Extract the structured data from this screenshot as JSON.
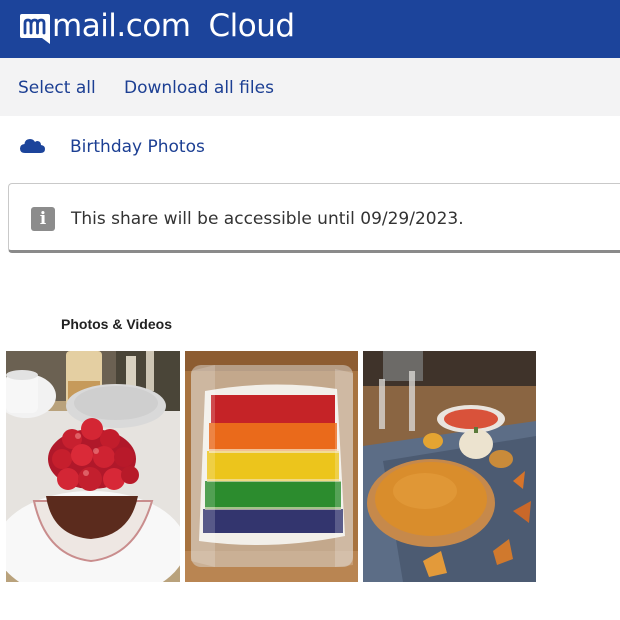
{
  "header": {
    "brand_mail": "mail.com",
    "brand_product": "Cloud",
    "colors": {
      "bar": "#1c449b",
      "text": "#ffffff"
    }
  },
  "toolbar": {
    "select_all": "Select all",
    "download_all": "Download all files"
  },
  "folder": {
    "icon": "cloud-icon",
    "name": "Birthday Photos"
  },
  "notice": {
    "icon": "info-icon",
    "icon_glyph": "i",
    "text": "This share will be accessible until 09/29/2023."
  },
  "gallery": {
    "title": "Photos & Videos",
    "items": [
      {
        "subject": "strawberry-tart-photo"
      },
      {
        "subject": "rainbow-cake-photo"
      },
      {
        "subject": "pumpkin-pie-photo"
      }
    ]
  },
  "colors": {
    "link": "#1c3f93",
    "toolbar_bg": "#f3f3f4"
  }
}
